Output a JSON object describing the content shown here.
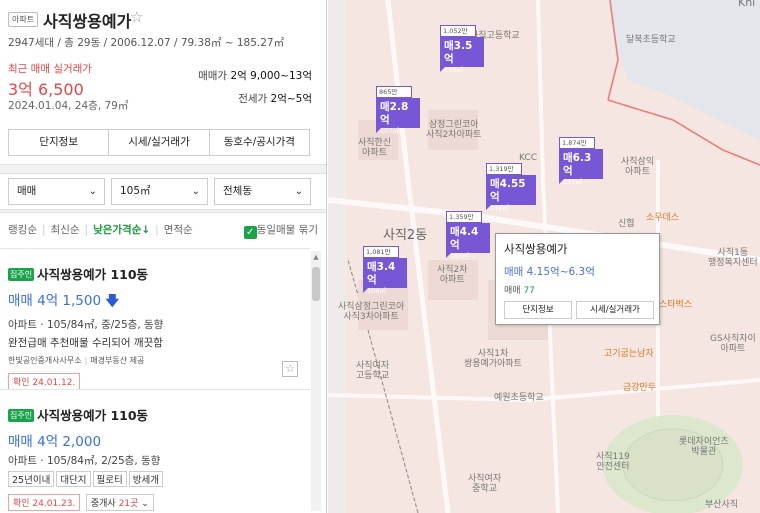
{
  "complex": {
    "type_tag": "아파트",
    "name": "사직쌍용예가",
    "meta": "2947세대 / 총 29동 / 2006.12.07 / 79.38㎡ ~ 185.27㎡"
  },
  "recent": {
    "label": "최근 매매 실거래가",
    "price": "3억 6,500",
    "date": "2024.01.04, 24층, 79㎡"
  },
  "ranges": [
    {
      "label": "매매가",
      "value": "2억 9,000~13억"
    },
    {
      "label": "전세가",
      "value": "2억~5억"
    }
  ],
  "info_tabs": [
    "단지정보",
    "시세/실거래가",
    "동호수/공시가격"
  ],
  "filters": [
    {
      "value": "매매"
    },
    {
      "value": "105㎡"
    },
    {
      "value": "전체동"
    }
  ],
  "sort": {
    "options": [
      "랭킹순",
      "최신순",
      "낮은가격순↓",
      "면적순"
    ],
    "active_index": 2,
    "same_listing_label": "동일매물 묶기"
  },
  "listings": [
    {
      "badge": "집주인",
      "name": "사직쌍용예가 110동",
      "price": "매매 4억 1,500",
      "price_drop_icon": "down-arrow",
      "desc": "아파트 · 105/84㎡, 중/25층, 동향",
      "line": "완전급매 추천매물 수리되어 깨끗함",
      "source_a": "한빛공인중개사사무소",
      "source_b": "매경부동산 제공",
      "confirmed": "확인 24.01.12."
    },
    {
      "badge": "집주인",
      "name": "사직쌍용예가 110동",
      "price": "매매 4억 2,000",
      "desc": "아파트 · 105/84㎡, 2/25층, 동향",
      "tags": [
        "25년이내",
        "대단지",
        "필로티",
        "방세개"
      ],
      "confirmed": "확인 24.01.23.",
      "agent_label": "중개사",
      "agent_count": "21곳"
    }
  ],
  "map": {
    "labels": [
      {
        "text": "사직고등학교",
        "cls": ""
      },
      {
        "text": "달북초등학교",
        "cls": ""
      },
      {
        "text": "삼정그린코아\n사직2차아파트",
        "cls": ""
      },
      {
        "text": "사직한신\n아파트",
        "cls": ""
      },
      {
        "text": "KCC",
        "cls": ""
      },
      {
        "text": "사직삼익\n아파트",
        "cls": ""
      },
      {
        "text": "사직2동",
        "cls": "bigdong"
      },
      {
        "text": "소우데스",
        "cls": "orange"
      },
      {
        "text": "신협",
        "cls": ""
      },
      {
        "text": "사직1동\n행정복지센터",
        "cls": ""
      },
      {
        "text": "사직삼정그린코아\n사직3차아파트",
        "cls": ""
      },
      {
        "text": "사직2차\n아파트",
        "cls": ""
      },
      {
        "text": "스타벅스",
        "cls": "orange"
      },
      {
        "text": "GS사직자이\n아파트",
        "cls": ""
      },
      {
        "text": "사직1차\n쌍용예가아파트",
        "cls": ""
      },
      {
        "text": "고기굽는남자",
        "cls": "orange"
      },
      {
        "text": "금강만두",
        "cls": "orange"
      },
      {
        "text": "사직여자\n고등학교",
        "cls": ""
      },
      {
        "text": "예원초등학교",
        "cls": ""
      },
      {
        "text": "사직119\n안전센터",
        "cls": ""
      },
      {
        "text": "롯데자이언츠\n박물관",
        "cls": ""
      },
      {
        "text": "사직여자\n중학교",
        "cls": ""
      },
      {
        "text": "부산사직",
        "cls": ""
      },
      {
        "text": "Khi",
        "cls": ""
      }
    ],
    "markers": [
      {
        "count": "1,052만",
        "price": "매3.5억",
        "area": "110㎡"
      },
      {
        "count": "865만",
        "price": "매2.8억",
        "area": "107㎡"
      },
      {
        "count": "1,874만",
        "price": "매6.3억",
        "area": "111㎡"
      },
      {
        "count": "1,319만",
        "price": "매4.55억",
        "area": "114㎡"
      },
      {
        "count": "1,359만",
        "price": "매4.4억",
        "area": "107㎡"
      },
      {
        "count": "1,081만",
        "price": "매3.4억",
        "area": "104㎡"
      }
    ],
    "popup": {
      "title": "사직쌍용예가",
      "price": "매매 4.15억~6.3억",
      "count_label": "매매",
      "count_value": "77",
      "buttons": [
        "단지정보",
        "시세/실거래가"
      ]
    }
  }
}
